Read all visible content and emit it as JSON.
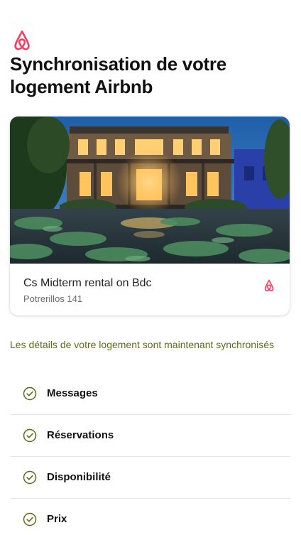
{
  "brand": {
    "logo_icon": "airbnb-logo-icon",
    "accent_color": "#FF385C"
  },
  "header": {
    "title": "Synchronisation de votre logement Airbnb"
  },
  "listing": {
    "name": "Cs Midterm rental on Bdc",
    "address": "Potrerillos 141",
    "photo": "illuminated-mansion-with-lily-pond-photo",
    "platform_icon": "airbnb-logo-icon"
  },
  "sync": {
    "message": "Les détails de votre logement sont maintenant synchronisés",
    "status_color": "#5D6B18",
    "items": [
      {
        "label": "Messages",
        "icon": "check-circle-icon"
      },
      {
        "label": "Réservations",
        "icon": "check-circle-icon"
      },
      {
        "label": "Disponibilité",
        "icon": "check-circle-icon"
      },
      {
        "label": "Prix",
        "icon": "check-circle-icon"
      }
    ]
  }
}
